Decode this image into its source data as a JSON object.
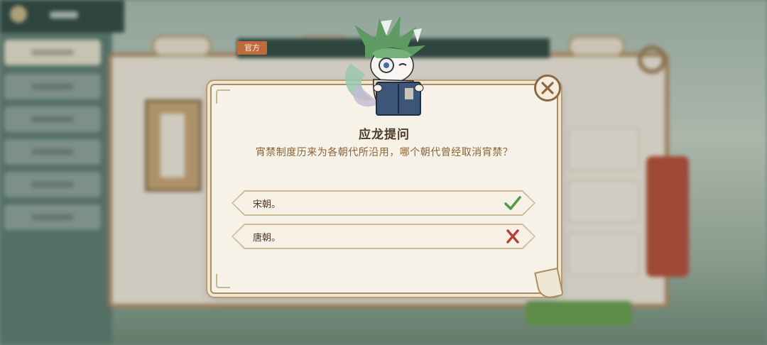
{
  "badge": {
    "label": "官方"
  },
  "dialog": {
    "title": "应龙提问",
    "question": "宵禁制度历来为各朝代所沿用，哪个朝代曾经取消宵禁？",
    "options": [
      {
        "label": "宋朝。",
        "result": "correct",
        "icon": "check-icon"
      },
      {
        "label": "唐朝。",
        "result": "wrong",
        "icon": "cross-icon"
      }
    ],
    "close_icon": "close-icon"
  },
  "colors": {
    "panel": "#f7f2e7",
    "border": "#a98c63",
    "title": "#4b3a26",
    "question": "#8a6337",
    "correct": "#4f9a4a",
    "wrong": "#b2413b",
    "badge": "#c06a3c"
  }
}
